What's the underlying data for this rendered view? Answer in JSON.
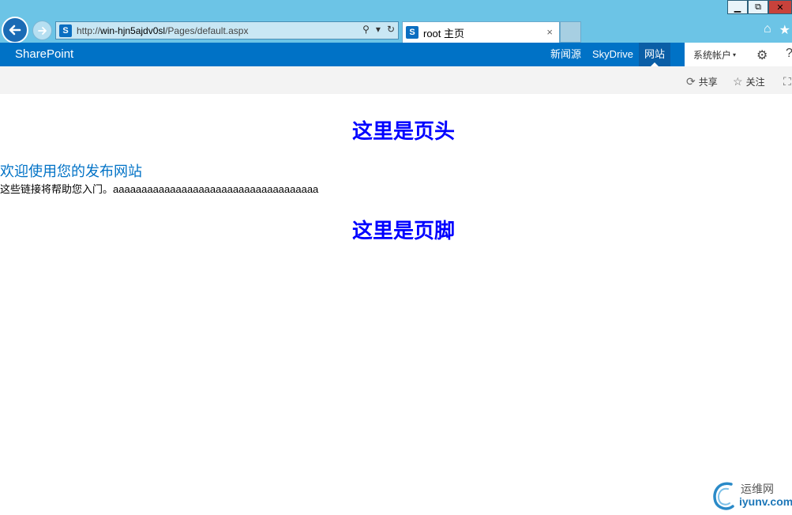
{
  "window": {
    "controls": {
      "minimize": "▁",
      "restore": "⧉",
      "close": "✕"
    }
  },
  "browser": {
    "address": {
      "prefix": "http://",
      "host": "win-hjn5ajdv0sl",
      "path": "/Pages/default.aspx",
      "search_icon": "⚲",
      "dropdown_icon": "▾",
      "refresh_icon": "↻"
    },
    "tab": {
      "title": "root 主页",
      "close": "×"
    },
    "toolbar_icons": {
      "home": "⌂",
      "favorites": "★"
    },
    "site_icon_letter": "S"
  },
  "suitebar": {
    "brand": "SharePoint",
    "links": [
      "新闻源",
      "SkyDrive",
      "网站"
    ],
    "account": "系统帐户",
    "account_caret": "▾",
    "settings_icon": "⚙",
    "help_icon": "?"
  },
  "ribbon": {
    "share": "共享",
    "follow": "关注",
    "share_icon": "⟳",
    "follow_icon": "☆",
    "focus_icon": "⛶"
  },
  "content": {
    "header": "这里是页头",
    "welcome": "欢迎使用您的发布网站",
    "intro": "这些链接将帮助您入门。aaaaaaaaaaaaaaaaaaaaaaaaaaaaaaaaaaaa",
    "footer": "这里是页脚"
  },
  "watermark": {
    "top": "运维网",
    "bottom": "iyunv.com"
  },
  "colors": {
    "suitebar": "#0072c6",
    "headline": "#0000ff",
    "link": "#0072c6",
    "ie_frame": "#6cc4e6"
  }
}
